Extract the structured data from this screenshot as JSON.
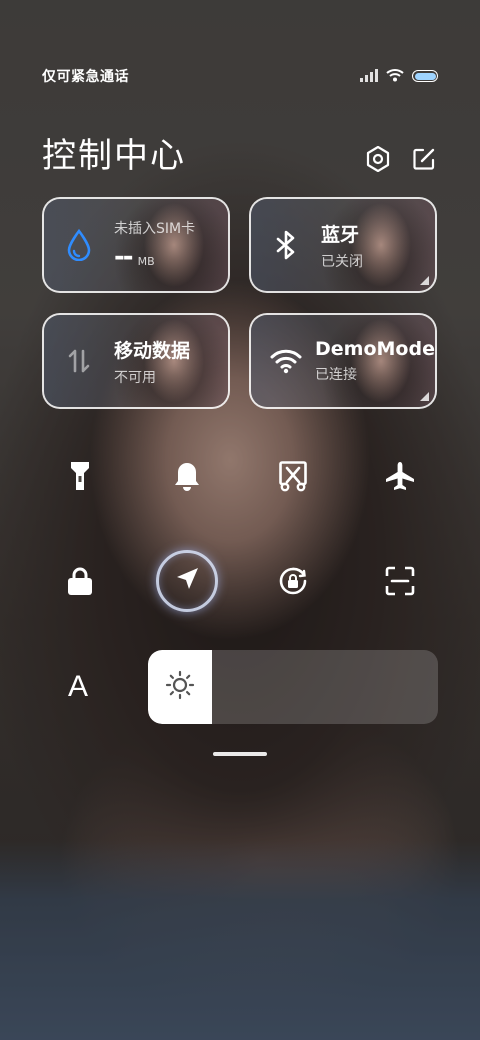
{
  "status_bar": {
    "carrier_text": "仅可紧急通话",
    "signal_icon": "signal-icon",
    "wifi_icon": "wifi-icon",
    "battery_icon": "battery-icon"
  },
  "header": {
    "title": "控制中心",
    "settings_icon": "settings-icon",
    "edit_icon": "edit-icon"
  },
  "tiles": {
    "data_usage": {
      "label": "未插入SIM卡",
      "value": "--",
      "unit": "MB",
      "icon": "water-drop-icon"
    },
    "bluetooth": {
      "label": "蓝牙",
      "status": "已关闭",
      "icon": "bluetooth-icon"
    },
    "mobile_data": {
      "label": "移动数据",
      "status": "不可用",
      "icon": "mobile-data-icon"
    },
    "wifi": {
      "label": "DemoMode",
      "status": "已连接",
      "icon": "wifi-icon"
    }
  },
  "toggles_row1": [
    "flashlight-icon",
    "bell-icon",
    "screen-cast-icon",
    "airplane-icon"
  ],
  "toggles_row2": [
    "lock-icon",
    "location-icon",
    "rotation-lock-icon",
    "scan-icon"
  ],
  "bottom": {
    "font_label": "A",
    "brightness_icon": "sun-icon",
    "brightness_level": 0.22
  },
  "colors": {
    "accent_blue": "#2f8cff",
    "battery_fill": "#9fd4ff"
  }
}
